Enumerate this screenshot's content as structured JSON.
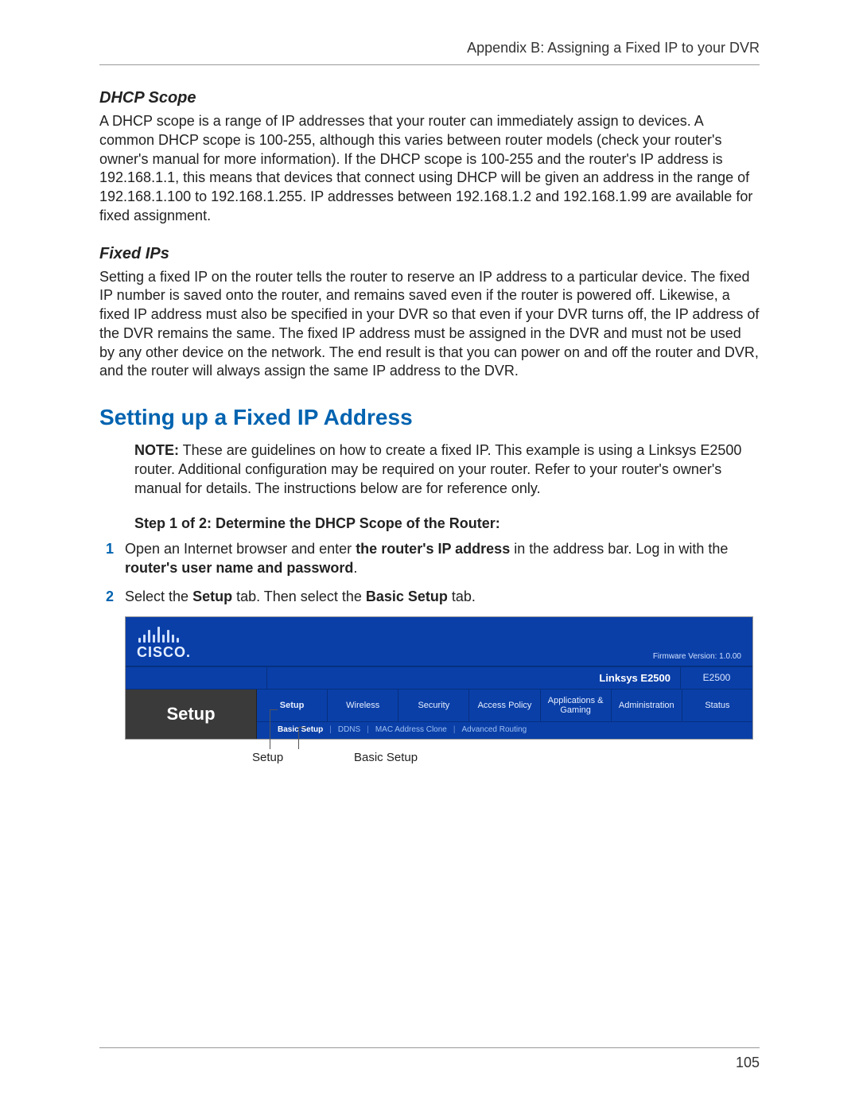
{
  "header": {
    "appendix_text": "Appendix B: Assigning a Fixed IP to your DVR"
  },
  "sections": {
    "dhcp_scope": {
      "title": "DHCP Scope",
      "body": "A DHCP scope is a range of IP addresses that your router can immediately assign to devices. A common DHCP scope is 100-255, although this varies between router models (check your router's owner's manual for more information). If the DHCP scope is 100-255 and the router's IP address is 192.168.1.1, this means that devices that connect using DHCP will be given an address in the range of 192.168.1.100 to 192.168.1.255. IP addresses between 192.168.1.2 and 192.168.1.99 are available for fixed assignment."
    },
    "fixed_ips": {
      "title": "Fixed IPs",
      "body": "Setting a fixed IP on the router tells the router to reserve an IP address to a particular device. The fixed IP number is saved onto the router, and remains saved even if the router is powered off. Likewise, a fixed IP address must also be specified in your DVR so that even if your DVR turns off, the IP address of the DVR remains the same. The fixed IP address must be assigned in the DVR and must not be used by any other device on the network. The end result is that you can power on and off the router and DVR, and the router will always assign the same IP address to the DVR."
    }
  },
  "main_heading": "Setting up a Fixed IP Address",
  "note": {
    "label": "NOTE:",
    "body": " These are guidelines on how to create a fixed IP. This example is using a Linksys E2500 router. Additional configuration may be required on your router. Refer to your router's owner's manual for details. The instructions below are for reference only."
  },
  "step_heading": "Step 1 of 2: Determine the DHCP Scope of the Router:",
  "steps": [
    {
      "num": "1",
      "pre": "Open an Internet browser and enter ",
      "bold1": "the router's IP address",
      "mid": " in the address bar. Log in with the ",
      "bold2": "router's user name and password",
      "post": "."
    },
    {
      "num": "2",
      "pre": "Select the ",
      "bold1": "Setup",
      "mid": " tab. Then select the ",
      "bold2": "Basic Setup",
      "post": " tab."
    }
  ],
  "router": {
    "brand": "CISCO.",
    "firmware": "Firmware Version: 1.0.00",
    "model_main": "Linksys E2500",
    "model_side": "E2500",
    "setup_label": "Setup",
    "tabs": [
      "Setup",
      "Wireless",
      "Security",
      "Access Policy",
      "Applications & Gaming",
      "Administration",
      "Status"
    ],
    "subtabs": [
      "Basic Setup",
      "DDNS",
      "MAC Address Clone",
      "Advanced Routing"
    ]
  },
  "callouts": {
    "setup": "Setup",
    "basic_setup": "Basic Setup"
  },
  "page_number": "105"
}
